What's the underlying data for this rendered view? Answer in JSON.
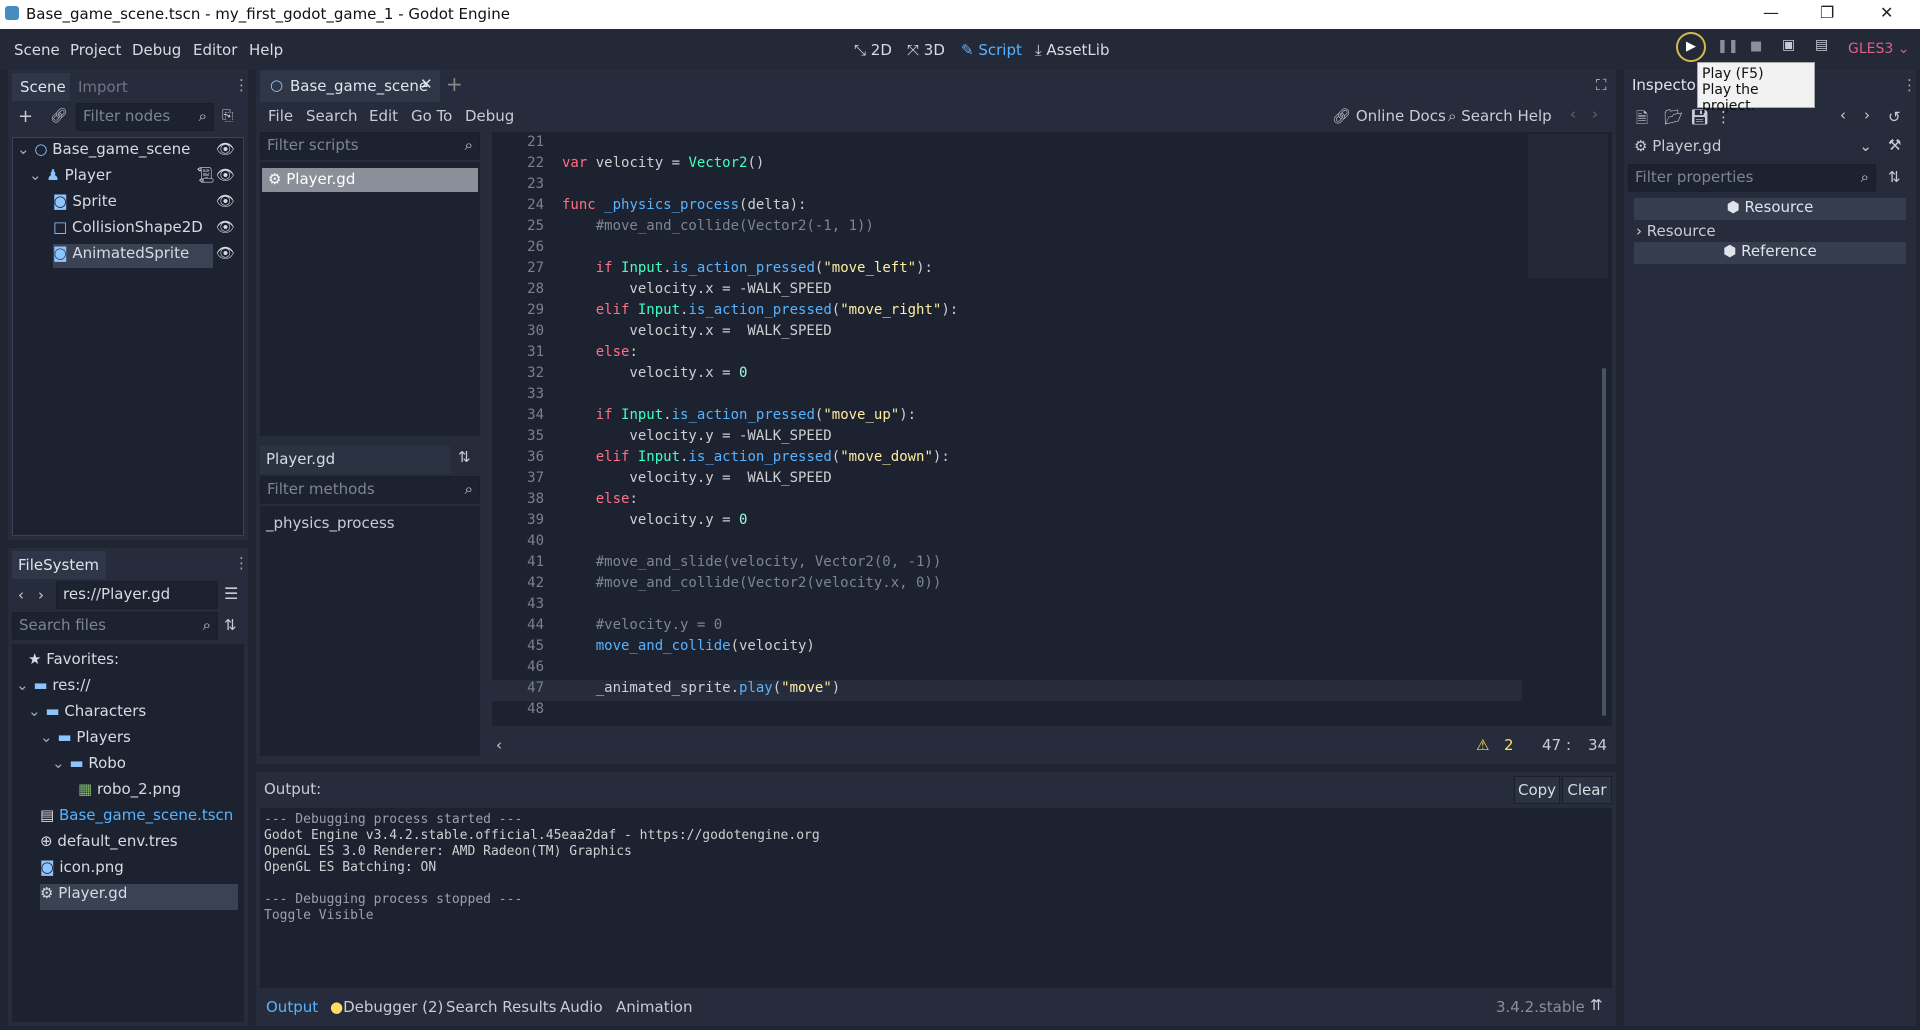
{
  "window": {
    "title": "Base_game_scene.tscn - my_first_godot_game_1 - Godot Engine",
    "minimize": "—",
    "maximize": "❐",
    "close": "✕"
  },
  "menu": [
    "Scene",
    "Project",
    "Debug",
    "Editor",
    "Help"
  ],
  "workspaces": {
    "w2d": "2D",
    "w3d": "3D",
    "script": "Script",
    "assetlib": "AssetLib"
  },
  "renderer": "GLES3",
  "tooltip": {
    "line1": "Play (F5)",
    "line2": "Play the project."
  },
  "scene_dock": {
    "tab_scene": "Scene",
    "tab_import": "Import",
    "filter_placeholder": "Filter nodes",
    "nodes": [
      {
        "label": "Base_game_scene",
        "depth": 0
      },
      {
        "label": "Player",
        "depth": 1
      },
      {
        "label": "Sprite",
        "depth": 2
      },
      {
        "label": "CollisionShape2D",
        "depth": 2
      },
      {
        "label": "AnimatedSprite",
        "depth": 2
      }
    ]
  },
  "filesystem": {
    "tab": "FileSystem",
    "path": "res://Player.gd",
    "search_placeholder": "Search files",
    "items": [
      {
        "label": "Favorites:",
        "depth": 0,
        "icon": "star"
      },
      {
        "label": "res://",
        "depth": 0,
        "icon": "folder"
      },
      {
        "label": "Characters",
        "depth": 1,
        "icon": "folder"
      },
      {
        "label": "Players",
        "depth": 2,
        "icon": "folder"
      },
      {
        "label": "Robo",
        "depth": 3,
        "icon": "folder"
      },
      {
        "label": "robo_2.png",
        "depth": 4,
        "icon": "image"
      },
      {
        "label": "Base_game_scene.tscn",
        "depth": 1,
        "icon": "scene"
      },
      {
        "label": "default_env.tres",
        "depth": 1,
        "icon": "globe"
      },
      {
        "label": "icon.png",
        "depth": 1,
        "icon": "image"
      },
      {
        "label": "Player.gd",
        "depth": 1,
        "icon": "gear"
      }
    ]
  },
  "editor_tab": "Base_game_scene",
  "script_menu": [
    "File",
    "Search",
    "Edit",
    "Go To",
    "Debug"
  ],
  "online_docs": "Online Docs",
  "search_help": "Search Help",
  "scripts_filter": "Filter scripts",
  "script_item": "Player.gd",
  "methods_title": "Player.gd",
  "methods_filter": "Filter methods",
  "method_item": "_physics_process",
  "code": [
    {
      "n": "21",
      "html": ""
    },
    {
      "n": "22",
      "html": "<span class='kw'>var</span> <span class='tx'>velocity = </span><span class='ty'>Vector2</span><span class='tx'>()</span>"
    },
    {
      "n": "23",
      "html": ""
    },
    {
      "n": "24",
      "html": "<span class='kw'>func</span> <span class='fn'>_physics_process</span><span class='tx'>(delta):</span>"
    },
    {
      "n": "25",
      "html": "<span class='cm'>    #move_and_collide(Vector2(-1, 1))</span>"
    },
    {
      "n": "26",
      "html": ""
    },
    {
      "n": "27",
      "html": "    <span class='kw'>if</span> <span class='ty'>Input</span><span class='tx'>.</span><span class='fn'>is_action_pressed</span><span class='tx'>(</span><span class='str'>\"move_left\"</span><span class='tx'>):</span>"
    },
    {
      "n": "28",
      "html": "<span class='tx'>        velocity.x = -WALK_SPEED</span>"
    },
    {
      "n": "29",
      "html": "    <span class='kw'>elif</span> <span class='ty'>Input</span><span class='tx'>.</span><span class='fn'>is_action_pressed</span><span class='tx'>(</span><span class='str'>\"move_right\"</span><span class='tx'>):</span>"
    },
    {
      "n": "30",
      "html": "<span class='tx'>        velocity.x =  WALK_SPEED</span>"
    },
    {
      "n": "31",
      "html": "    <span class='kw'>else</span><span class='tx'>:</span>"
    },
    {
      "n": "32",
      "html": "<span class='tx'>        velocity.x = </span><span class='num'>0</span>"
    },
    {
      "n": "33",
      "html": ""
    },
    {
      "n": "34",
      "html": "    <span class='kw'>if</span> <span class='ty'>Input</span><span class='tx'>.</span><span class='fn'>is_action_pressed</span><span class='tx'>(</span><span class='str'>\"move_up\"</span><span class='tx'>):</span>"
    },
    {
      "n": "35",
      "html": "<span class='tx'>        velocity.y = -WALK_SPEED</span>"
    },
    {
      "n": "36",
      "html": "    <span class='kw'>elif</span> <span class='ty'>Input</span><span class='tx'>.</span><span class='fn'>is_action_pressed</span><span class='tx'>(</span><span class='str'>\"move_down\"</span><span class='tx'>):</span>"
    },
    {
      "n": "37",
      "html": "<span class='tx'>        velocity.y =  WALK_SPEED</span>"
    },
    {
      "n": "38",
      "html": "    <span class='kw'>else</span><span class='tx'>:</span>"
    },
    {
      "n": "39",
      "html": "<span class='tx'>        velocity.y = </span><span class='num'>0</span>"
    },
    {
      "n": "40",
      "html": ""
    },
    {
      "n": "41",
      "html": "<span class='cm'>    #move_and_slide(velocity, Vector2(0, -1))</span>"
    },
    {
      "n": "42",
      "html": "<span class='cm'>    #move_and_collide(Vector2(velocity.x, 0))</span>"
    },
    {
      "n": "43",
      "html": ""
    },
    {
      "n": "44",
      "html": "<span class='cm'>    #velocity.y = 0</span>"
    },
    {
      "n": "45",
      "html": "    <span class='fn'>move_and_collide</span><span class='tx'>(velocity)</span>"
    },
    {
      "n": "46",
      "html": ""
    },
    {
      "n": "47",
      "html": "<span class='tx'>    _animated_sprite.</span><span class='fn'>play</span><span class='tx'>(</span><span class='str'>\"move\"</span><span class='tx'>)</span>"
    },
    {
      "n": "48",
      "html": ""
    }
  ],
  "status": {
    "warnings": "2",
    "line": "47",
    "sep": ":",
    "col": "34"
  },
  "output": {
    "title": "Output:",
    "copy": "Copy",
    "clear": "Clear",
    "lines": [
      "--- Debugging process started ---",
      "Godot Engine v3.4.2.stable.official.45eaa2daf - https://godotengine.org",
      "OpenGL ES 3.0 Renderer: AMD Radeon(TM) Graphics",
      "OpenGL ES Batching: ON",
      "",
      "--- Debugging process stopped ---",
      "Toggle Visible"
    ]
  },
  "bottom_tabs": [
    "Output",
    "Debugger (2)",
    "Search Results",
    "Audio",
    "Animation"
  ],
  "version": "3.4.2.stable",
  "inspector": {
    "tab": "Inspector",
    "object": "Player.gd",
    "filter_placeholder": "Filter properties",
    "section1": "Resource",
    "group": "Resource",
    "section2": "Reference"
  },
  "colors": {
    "accent": "#57b3ff",
    "bg": "#202531",
    "panel": "#262c3b",
    "warning": "#ffdd65",
    "renderer": "#e0608a"
  }
}
